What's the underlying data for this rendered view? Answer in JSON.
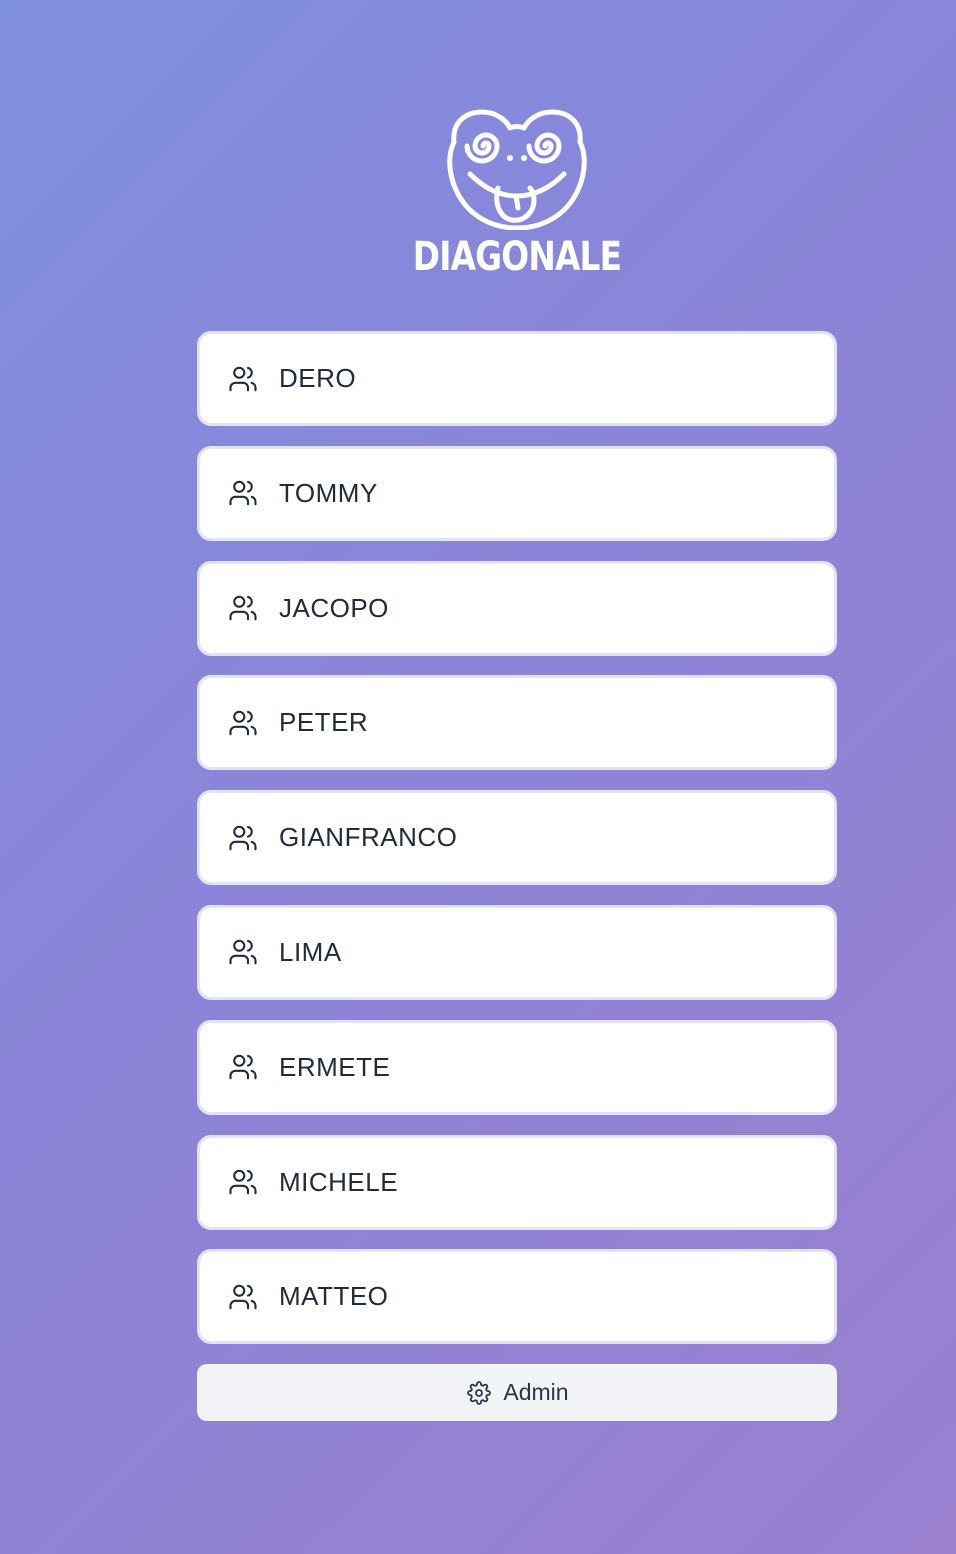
{
  "app": {
    "logo_text": "DIAGONALE",
    "logo_icon": "frog-face-logo"
  },
  "users": [
    {
      "label": "DERO",
      "icon": "users-icon"
    },
    {
      "label": "TOMMY",
      "icon": "users-icon"
    },
    {
      "label": "JACOPO",
      "icon": "users-icon"
    },
    {
      "label": "PETER",
      "icon": "users-icon"
    },
    {
      "label": "GIANFRANCO",
      "icon": "users-icon"
    },
    {
      "label": "LIMA",
      "icon": "users-icon"
    },
    {
      "label": "ERMETE",
      "icon": "users-icon"
    },
    {
      "label": "MICHELE",
      "icon": "users-icon"
    },
    {
      "label": "MATTEO",
      "icon": "users-icon"
    }
  ],
  "admin": {
    "label": "Admin",
    "icon": "gear-icon"
  },
  "colors": {
    "background_start": "#7f8fe0",
    "background_end": "#9a80cf",
    "button_bg": "#ffffff",
    "button_border": "#e3e3f7",
    "text": "#232a3a",
    "admin_bg": "#f2f3f6"
  }
}
